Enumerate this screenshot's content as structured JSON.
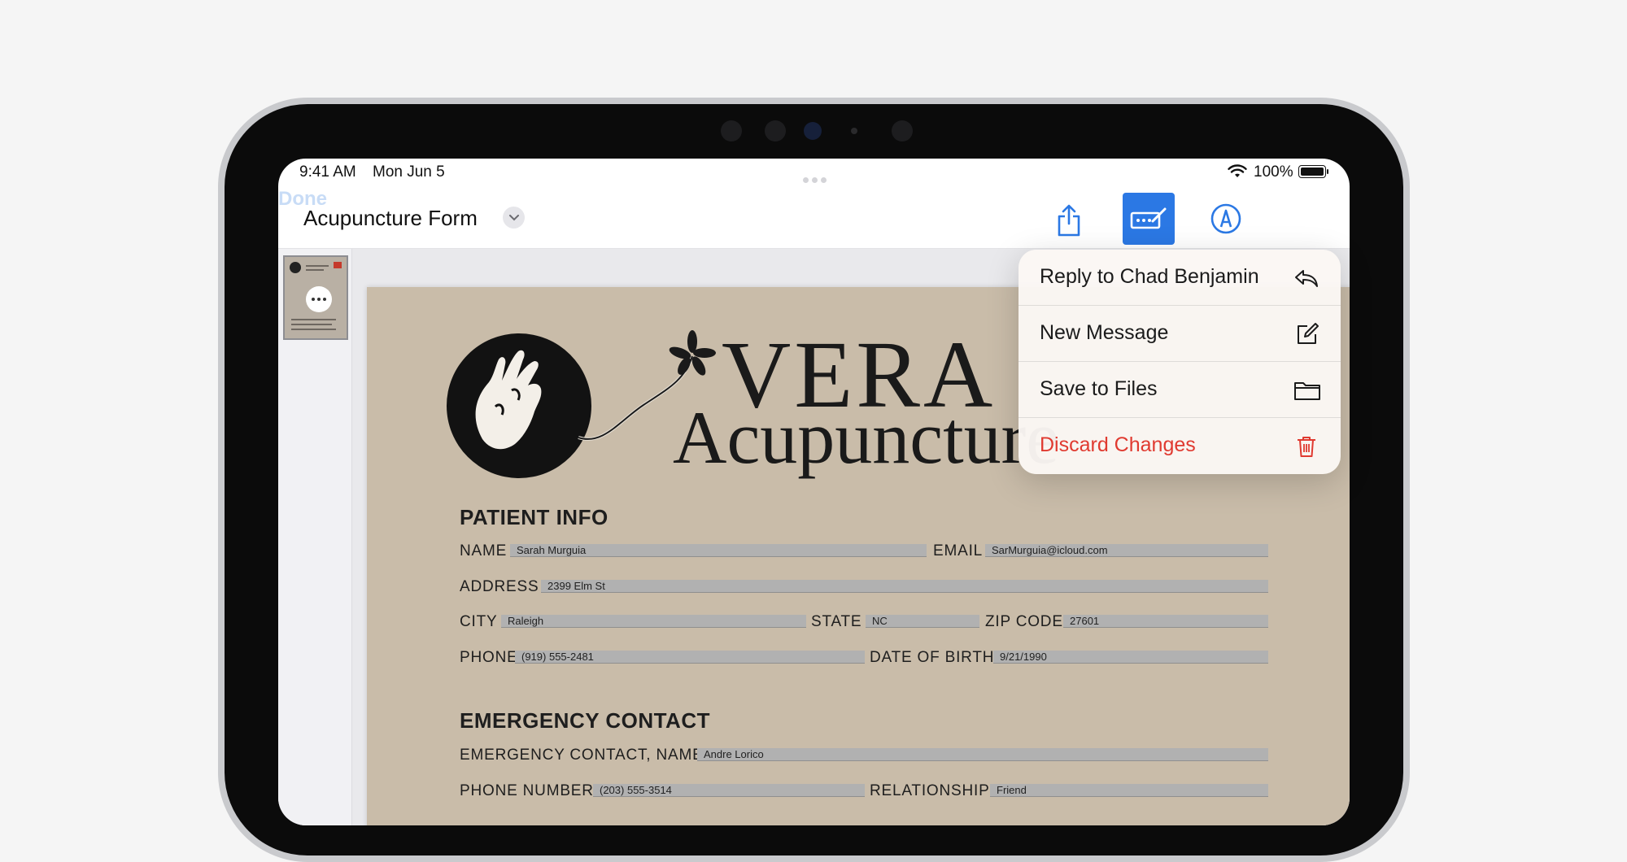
{
  "status_bar": {
    "time": "9:41 AM",
    "date": "Mon Jun 5",
    "battery": "100%"
  },
  "nav": {
    "title": "Acupuncture Form",
    "done_label": "Done"
  },
  "menu": {
    "items": [
      {
        "label": "Reply to Chad Benjamin",
        "icon": "reply-icon"
      },
      {
        "label": "New Message",
        "icon": "compose-icon"
      },
      {
        "label": "Save to Files",
        "icon": "folder-icon"
      },
      {
        "label": "Discard Changes",
        "icon": "trash-icon",
        "color": "#e03a30"
      }
    ]
  },
  "form": {
    "brand_line1": "VERA",
    "brand_line2": "Acupuncture",
    "patient_info": {
      "heading": "PATIENT INFO",
      "name_label": "NAME",
      "name_value": "Sarah Murguia",
      "email_label": "EMAIL",
      "email_value": "SarMurguia@icloud.com",
      "address_label": "ADDRESS",
      "address_value": "2399 Elm St",
      "city_label": "CITY",
      "city_value": "Raleigh",
      "state_label": "STATE",
      "state_value": "NC",
      "zip_label": "ZIP CODE",
      "zip_value": "27601",
      "phone_label": "PHONE",
      "phone_value": "(919) 555-2481",
      "dob_label": "DATE OF BIRTH",
      "dob_value": "9/21/1990"
    },
    "emergency_contact": {
      "heading": "EMERGENCY CONTACT",
      "name_label": "EMERGENCY CONTACT, NAME",
      "name_value": "Andre Lorico",
      "phone_label": "PHONE NUMBER",
      "phone_value": "(203) 555-3514",
      "relationship_label": "RELATIONSHIP",
      "relationship_value": "Friend"
    }
  },
  "colors": {
    "accent": "#2b78e4",
    "page": "#c9bca9",
    "destructive": "#e03a30"
  }
}
